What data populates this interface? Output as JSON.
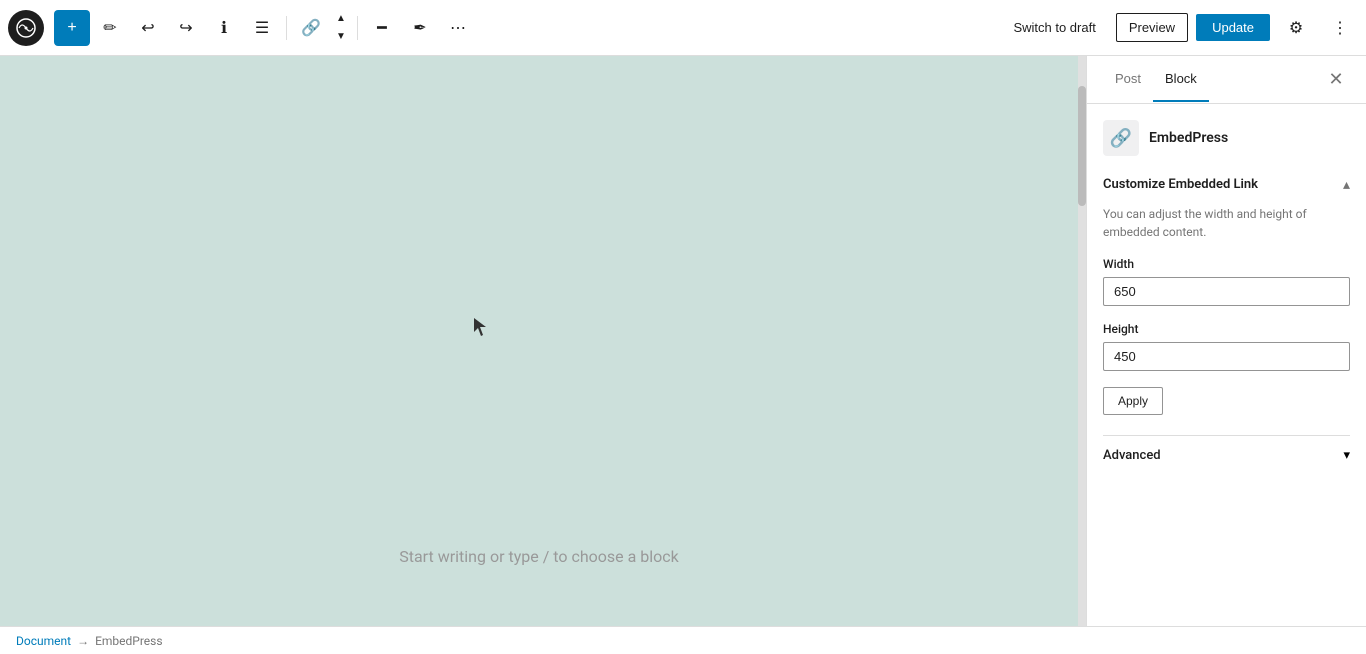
{
  "toolbar": {
    "wp_logo_alt": "WordPress",
    "add_label": "+",
    "tools_btn": "✏",
    "undo_btn": "↩",
    "redo_btn": "↪",
    "info_btn": "ⓘ",
    "list_view_btn": "≡",
    "link_btn": "🔗",
    "up_btn": "▲",
    "down_btn": "▼",
    "align_btn": "━",
    "highlighter_btn": "✒",
    "more_btn": "⋯",
    "switch_to_draft_label": "Switch to draft",
    "preview_label": "Preview",
    "update_label": "Update",
    "settings_icon": "⚙",
    "more_options_icon": "⋮"
  },
  "sidebar": {
    "post_tab_label": "Post",
    "block_tab_label": "Block",
    "close_icon": "✕",
    "block_name": "EmbedPress",
    "section_title": "Customize Embedded Link",
    "section_desc": "You can adjust the width and height of embedded content.",
    "width_label": "Width",
    "width_value": "650",
    "height_label": "Height",
    "height_value": "450",
    "apply_label": "Apply",
    "advanced_label": "Advanced",
    "chevron_down_icon": "▾",
    "chevron_up_icon": "▴"
  },
  "editor": {
    "placeholder": "Start writing or type / to choose a block"
  },
  "breadcrumb": {
    "document_label": "Document",
    "separator": "→",
    "block_label": "EmbedPress"
  }
}
